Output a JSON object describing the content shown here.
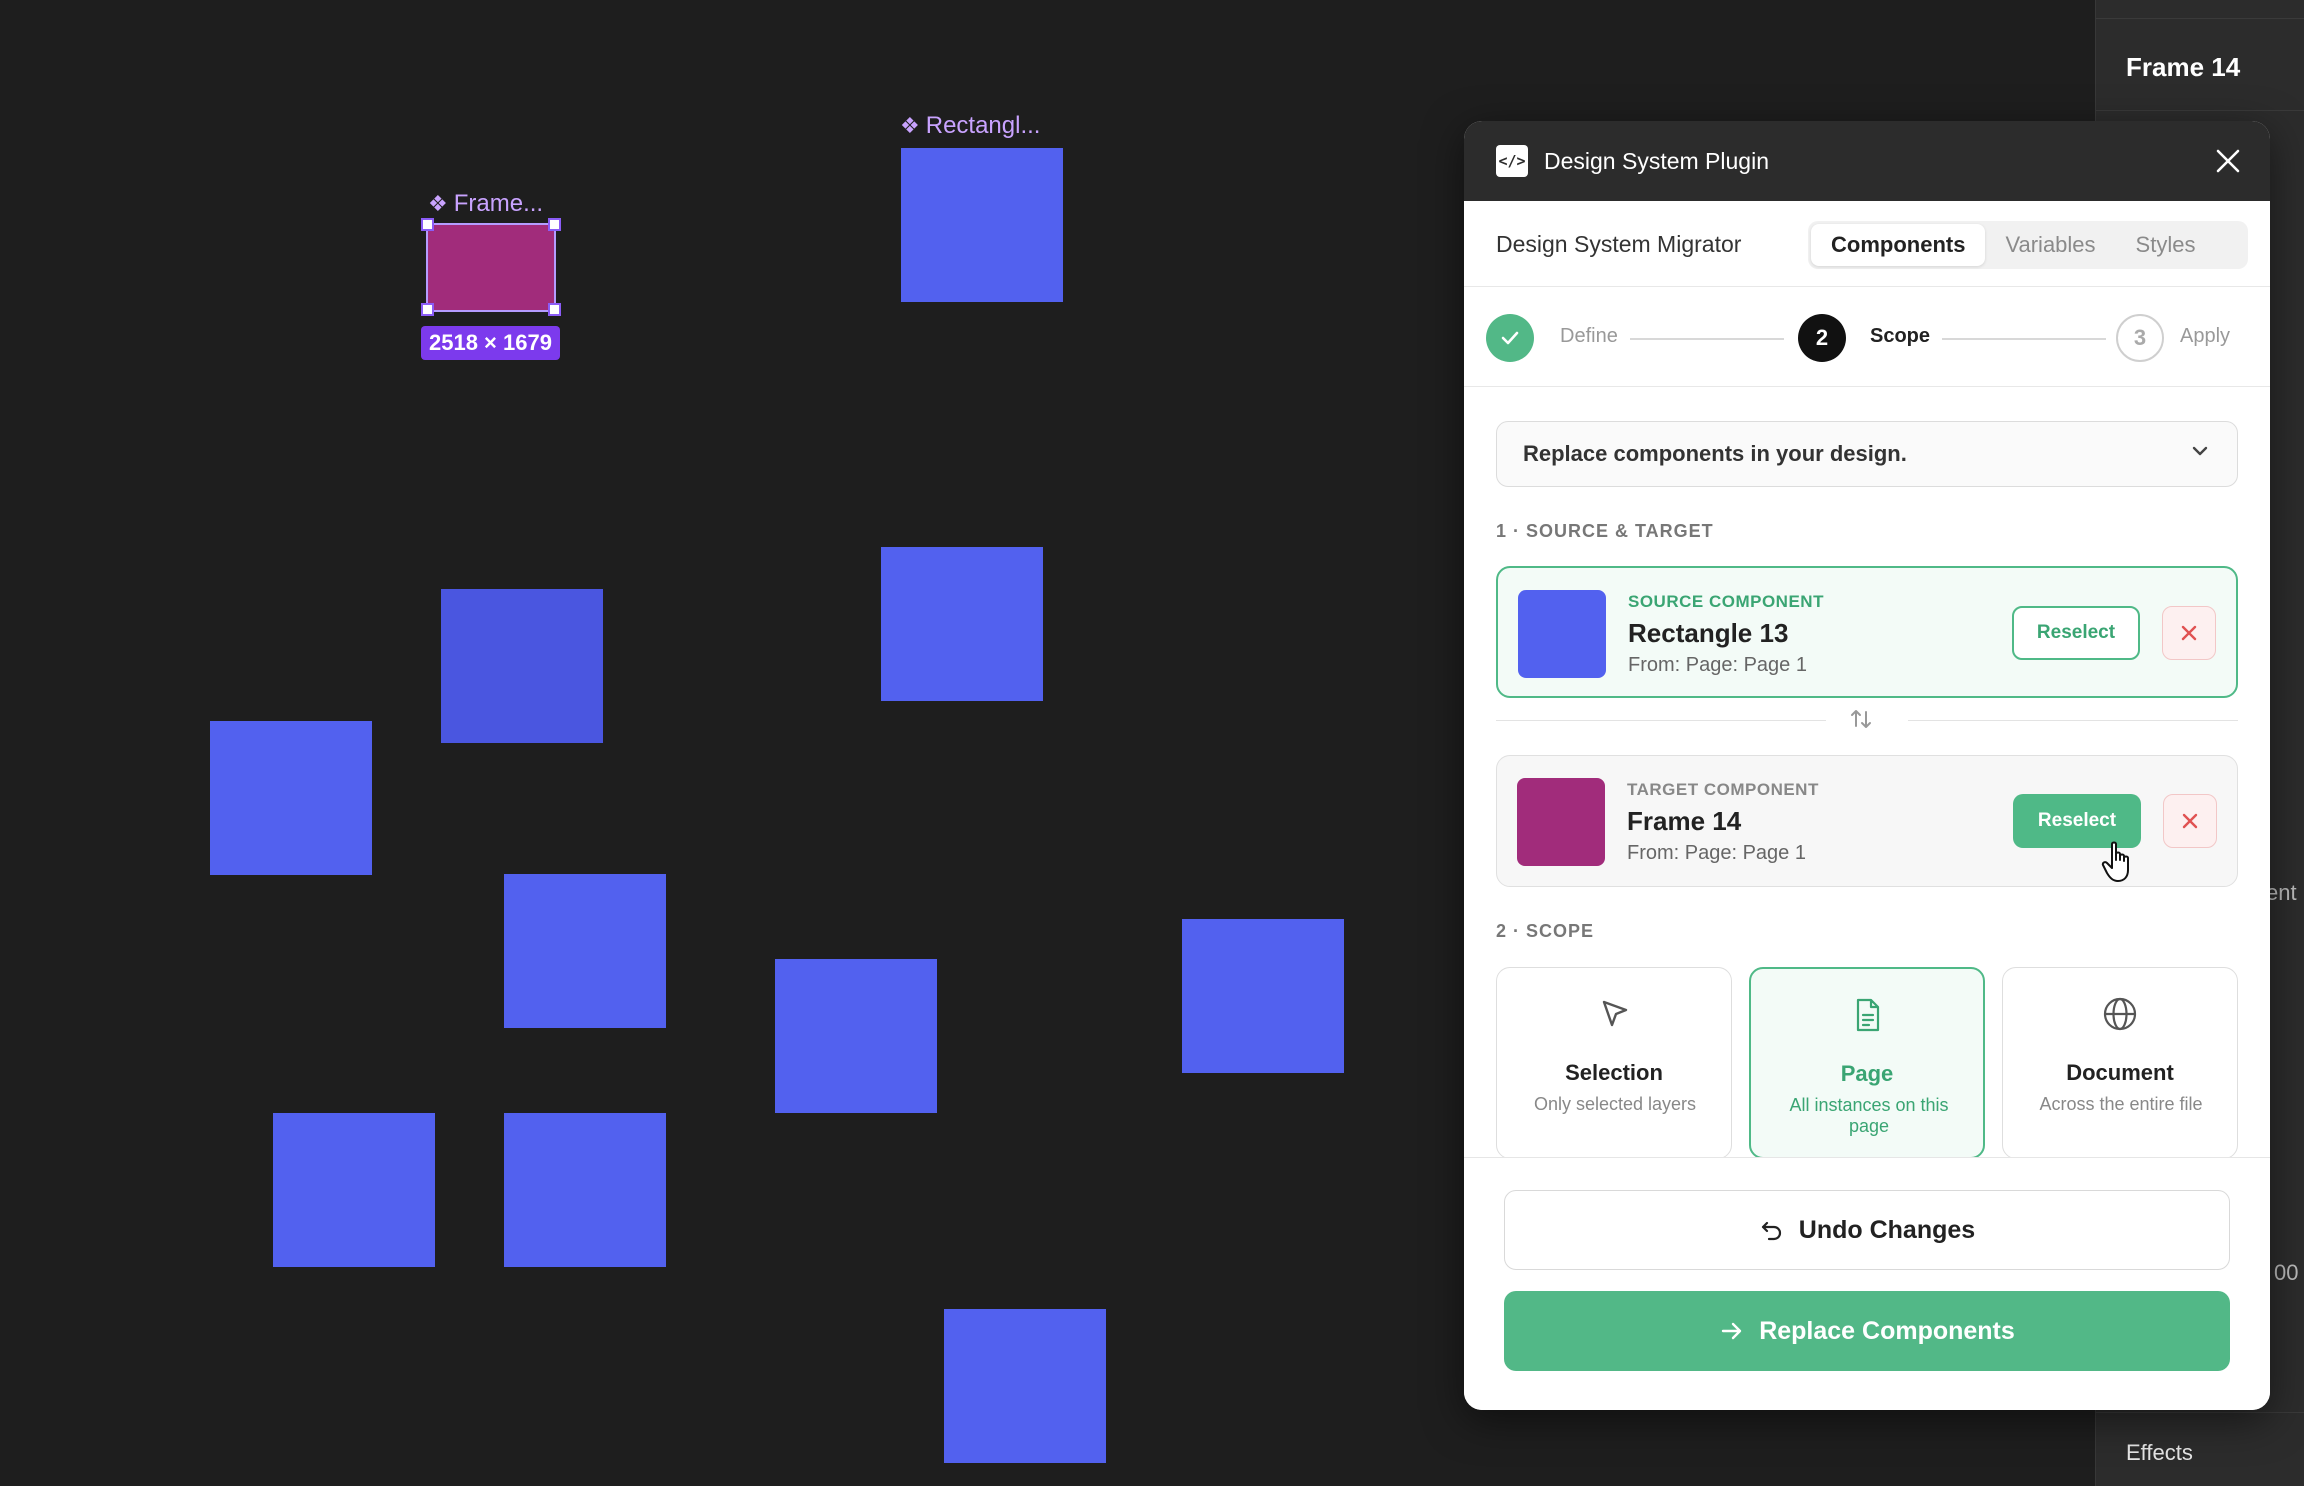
{
  "canvas": {
    "rect_label": "Rectangl...",
    "frame_label": "Frame...",
    "size_badge": "2518 × 1679",
    "colors": {
      "background": "#1e1e1e",
      "rect": "#5261ef",
      "frame": "#a12c7b",
      "selection": "#8b5cf6"
    }
  },
  "right_panel": {
    "title": "Frame 14",
    "effects_label": "Effects",
    "fragment_1": "ent",
    "fragment_2": "00"
  },
  "plugin": {
    "title": "Design System Plugin",
    "logo_glyph": "</>",
    "nav_title": "Design System Migrator",
    "tabs": [
      {
        "label": "Components",
        "active": true
      },
      {
        "label": "Variables",
        "active": false
      },
      {
        "label": "Styles",
        "active": false
      }
    ],
    "steps": [
      {
        "number": "1",
        "label": "Define",
        "state": "done"
      },
      {
        "number": "2",
        "label": "Scope",
        "state": "current"
      },
      {
        "number": "3",
        "label": "Apply",
        "state": "upcoming"
      }
    ],
    "intro_dropdown": "Replace components in your design.",
    "section_1": "1 · SOURCE & TARGET",
    "source": {
      "kicker": "SOURCE COMPONENT",
      "name": "Rectangle 13",
      "from": "From: Page: Page 1",
      "reselect": "Reselect",
      "color": "#5261ef"
    },
    "target": {
      "kicker": "TARGET COMPONENT",
      "name": "Frame 14",
      "from": "From: Page: Page 1",
      "reselect": "Reselect",
      "color": "#a12c7b"
    },
    "section_2": "2 · SCOPE",
    "scope_options": [
      {
        "title": "Selection",
        "desc": "Only selected layers",
        "active": false,
        "icon": "cursor-arrow-icon"
      },
      {
        "title": "Page",
        "desc": "All instances on this page",
        "active": true,
        "icon": "document-icon"
      },
      {
        "title": "Document",
        "desc": "Across the entire file",
        "active": false,
        "icon": "globe-icon"
      }
    ],
    "undo_label": "Undo Changes",
    "replace_label": "Replace Components",
    "accent": "#52b887",
    "danger": "#e05252"
  }
}
